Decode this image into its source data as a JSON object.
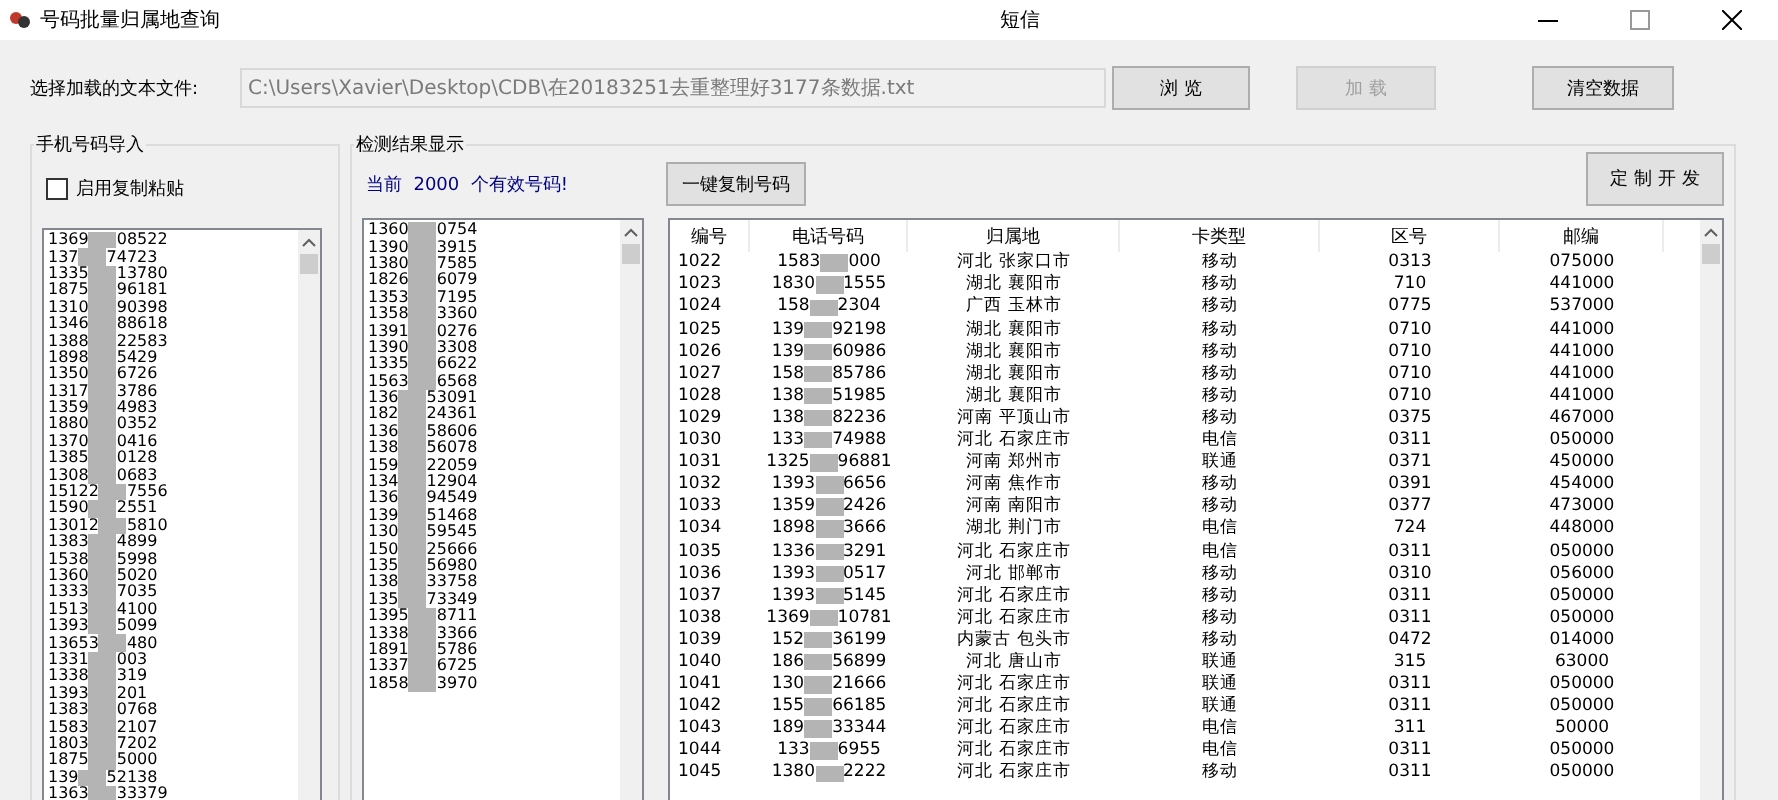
{
  "window": {
    "title": "号码批量归属地查询",
    "center_title": "短信"
  },
  "file_row": {
    "label": "选择加载的文本文件:",
    "path": "C:\\Users\\Xavier\\Desktop\\CDB\\在20183251去重整理好3177条数据.txt",
    "buttons": [
      {
        "label": "浏 览",
        "disabled": false
      },
      {
        "label": "加 载",
        "disabled": true
      },
      {
        "label": "清空数据",
        "disabled": false
      }
    ]
  },
  "import_group": {
    "title": "手机号码导入",
    "paste_checkbox": {
      "label": "启用复制粘贴",
      "checked": false
    },
    "numbers": [
      {
        "head": "1369",
        "tail": "08522"
      },
      {
        "head": "137",
        "tail": "74723"
      },
      {
        "head": "1335",
        "tail": "13780"
      },
      {
        "head": "1875",
        "tail": "96181"
      },
      {
        "head": "1310",
        "tail": "90398"
      },
      {
        "head": "1346",
        "tail": "88618"
      },
      {
        "head": "1388",
        "tail": "22583"
      },
      {
        "head": "1898",
        "tail": "5429"
      },
      {
        "head": "1350",
        "tail": "6726"
      },
      {
        "head": "1317",
        "tail": "3786"
      },
      {
        "head": "1359",
        "tail": "4983"
      },
      {
        "head": "1880",
        "tail": "0352"
      },
      {
        "head": "1370",
        "tail": "0416"
      },
      {
        "head": "1385",
        "tail": "0128"
      },
      {
        "head": "1308",
        "tail": "0683"
      },
      {
        "head": "15122",
        "tail": "7556"
      },
      {
        "head": "1590",
        "tail": "2551"
      },
      {
        "head": "13012",
        "tail": "5810"
      },
      {
        "head": "1383",
        "tail": "4899"
      },
      {
        "head": "1538",
        "tail": "5998"
      },
      {
        "head": "1360",
        "tail": "5020"
      },
      {
        "head": "1333",
        "tail": "7035"
      },
      {
        "head": "1513",
        "tail": "4100"
      },
      {
        "head": "1393",
        "tail": "5099"
      },
      {
        "head": "13653",
        "tail": "480"
      },
      {
        "head": "1331",
        "tail": "003"
      },
      {
        "head": "1338",
        "tail": "319"
      },
      {
        "head": "1393",
        "tail": "201"
      },
      {
        "head": "1383",
        "tail": "0768"
      },
      {
        "head": "1583",
        "tail": "2107"
      },
      {
        "head": "1803",
        "tail": "7202"
      },
      {
        "head": "1875",
        "tail": "5000"
      },
      {
        "head": "139",
        "tail": "52138"
      },
      {
        "head": "1363",
        "tail": "33379"
      }
    ]
  },
  "result_group": {
    "title": "检测结果显示",
    "count_text": "当前  2000  个有效号码!",
    "copy_button": "一键复制号码",
    "custom_button": "定 制 开 发",
    "valid_numbers": [
      {
        "head": "1360",
        "tail": "0754"
      },
      {
        "head": "1390",
        "tail": "3915"
      },
      {
        "head": "1380",
        "tail": "7585"
      },
      {
        "head": "1826",
        "tail": "6079"
      },
      {
        "head": "1353",
        "tail": "7195"
      },
      {
        "head": "1358",
        "tail": "3360"
      },
      {
        "head": "1391",
        "tail": "0276"
      },
      {
        "head": "1390",
        "tail": "3308"
      },
      {
        "head": "1335",
        "tail": "6622"
      },
      {
        "head": "1563",
        "tail": "6568"
      },
      {
        "head": "136",
        "tail": "53091"
      },
      {
        "head": "182",
        "tail": "24361"
      },
      {
        "head": "136",
        "tail": "58606"
      },
      {
        "head": "138",
        "tail": "56078"
      },
      {
        "head": "159",
        "tail": "22059"
      },
      {
        "head": "134",
        "tail": "12904"
      },
      {
        "head": "136",
        "tail": "94549"
      },
      {
        "head": "139",
        "tail": "51468"
      },
      {
        "head": "130",
        "tail": "59545"
      },
      {
        "head": "150",
        "tail": "25666"
      },
      {
        "head": "135",
        "tail": "56980"
      },
      {
        "head": "138",
        "tail": "33758"
      },
      {
        "head": "135",
        "tail": "73349"
      },
      {
        "head": "1395",
        "tail": "8711"
      },
      {
        "head": "1338",
        "tail": "3366"
      },
      {
        "head": "1891",
        "tail": "5786"
      },
      {
        "head": "1337",
        "tail": "6725"
      },
      {
        "head": "1858",
        "tail": "3970"
      }
    ],
    "table": {
      "columns": [
        "编号",
        "电话号码",
        "归属地",
        "卡类型",
        "区号",
        "邮编"
      ],
      "rows": [
        {
          "id": "1022",
          "head": "1583",
          "tail": "000",
          "place": "河北 张家口市",
          "type": "移动",
          "area": "0313",
          "zip": "075000"
        },
        {
          "id": "1023",
          "head": "1830",
          "tail": "1555",
          "place": "湖北 襄阳市",
          "type": "移动",
          "area": "710",
          "zip": "441000"
        },
        {
          "id": "1024",
          "head": "158",
          "tail": "2304",
          "place": "广西 玉林市",
          "type": "移动",
          "area": "0775",
          "zip": "537000"
        },
        {
          "id": "1025",
          "head": "139",
          "tail": "92198",
          "place": "湖北 襄阳市",
          "type": "移动",
          "area": "0710",
          "zip": "441000"
        },
        {
          "id": "1026",
          "head": "139",
          "tail": "60986",
          "place": "湖北 襄阳市",
          "type": "移动",
          "area": "0710",
          "zip": "441000"
        },
        {
          "id": "1027",
          "head": "158",
          "tail": "85786",
          "place": "湖北 襄阳市",
          "type": "移动",
          "area": "0710",
          "zip": "441000"
        },
        {
          "id": "1028",
          "head": "138",
          "tail": "51985",
          "place": "湖北 襄阳市",
          "type": "移动",
          "area": "0710",
          "zip": "441000"
        },
        {
          "id": "1029",
          "head": "138",
          "tail": "82236",
          "place": "河南 平顶山市",
          "type": "移动",
          "area": "0375",
          "zip": "467000"
        },
        {
          "id": "1030",
          "head": "133",
          "tail": "74988",
          "place": "河北 石家庄市",
          "type": "电信",
          "area": "0311",
          "zip": "050000"
        },
        {
          "id": "1031",
          "head": "1325",
          "tail": "96881",
          "place": "河南 郑州市",
          "type": "联通",
          "area": "0371",
          "zip": "450000"
        },
        {
          "id": "1032",
          "head": "1393",
          "tail": "6656",
          "place": "河南 焦作市",
          "type": "移动",
          "area": "0391",
          "zip": "454000"
        },
        {
          "id": "1033",
          "head": "1359",
          "tail": "2426",
          "place": "河南 南阳市",
          "type": "移动",
          "area": "0377",
          "zip": "473000"
        },
        {
          "id": "1034",
          "head": "1898",
          "tail": "3666",
          "place": "湖北 荆门市",
          "type": "电信",
          "area": "724",
          "zip": "448000"
        },
        {
          "id": "1035",
          "head": "1336",
          "tail": "3291",
          "place": "河北 石家庄市",
          "type": "电信",
          "area": "0311",
          "zip": "050000"
        },
        {
          "id": "1036",
          "head": "1393",
          "tail": "0517",
          "place": "河北 邯郸市",
          "type": "移动",
          "area": "0310",
          "zip": "056000"
        },
        {
          "id": "1037",
          "head": "1393",
          "tail": "5145",
          "place": "河北 石家庄市",
          "type": "移动",
          "area": "0311",
          "zip": "050000"
        },
        {
          "id": "1038",
          "head": "1369",
          "tail": "10781",
          "place": "河北 石家庄市",
          "type": "移动",
          "area": "0311",
          "zip": "050000"
        },
        {
          "id": "1039",
          "head": "152",
          "tail": "36199",
          "place": "内蒙古 包头市",
          "type": "移动",
          "area": "0472",
          "zip": "014000"
        },
        {
          "id": "1040",
          "head": "186",
          "tail": "56899",
          "place": "河北 唐山市",
          "type": "联通",
          "area": "315",
          "zip": "63000"
        },
        {
          "id": "1041",
          "head": "130",
          "tail": "21666",
          "place": "河北 石家庄市",
          "type": "联通",
          "area": "0311",
          "zip": "050000"
        },
        {
          "id": "1042",
          "head": "155",
          "tail": "66185",
          "place": "河北 石家庄市",
          "type": "联通",
          "area": "0311",
          "zip": "050000"
        },
        {
          "id": "1043",
          "head": "189",
          "tail": "33344",
          "place": "河北 石家庄市",
          "type": "电信",
          "area": "311",
          "zip": "50000"
        },
        {
          "id": "1044",
          "head": "133",
          "tail": "6955",
          "place": "河北 石家庄市",
          "type": "电信",
          "area": "0311",
          "zip": "050000"
        },
        {
          "id": "1045",
          "head": "1380",
          "tail": "2222",
          "place": "河北 石家庄市",
          "type": "移动",
          "area": "0311",
          "zip": "050000"
        }
      ]
    }
  }
}
